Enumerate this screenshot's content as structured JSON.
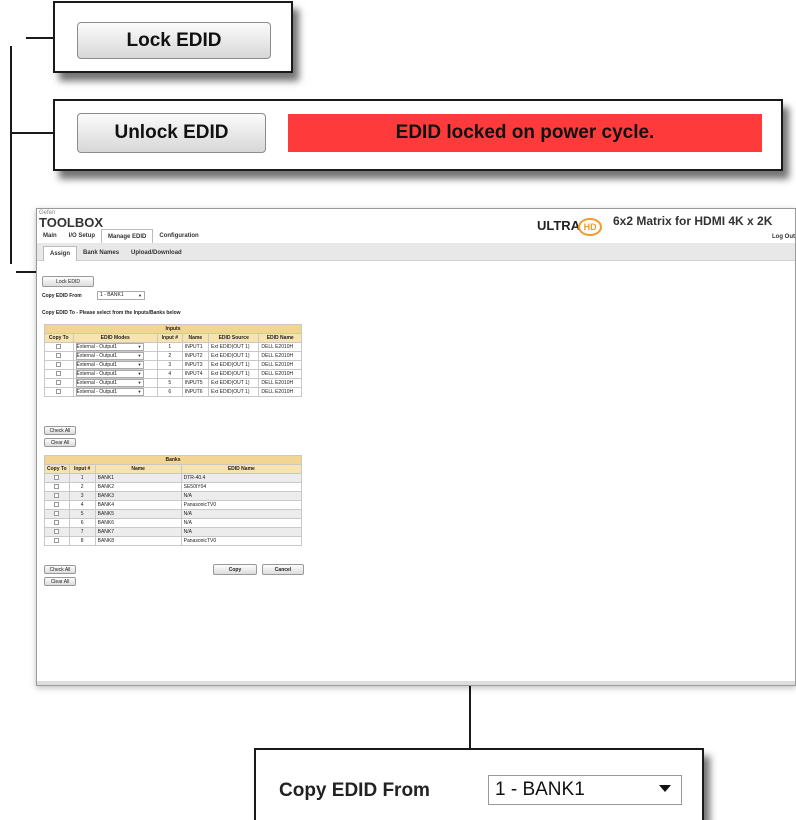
{
  "callout_lock": {
    "button_label": "Lock EDID"
  },
  "callout_unlock": {
    "button_label": "Unlock EDID",
    "status_banner": "EDID locked on power cycle."
  },
  "callout_copy": {
    "label": "Copy EDID From",
    "select_value": "1 - BANK1"
  },
  "app": {
    "brand_small": "Gefen",
    "brand": "TOOLBOX",
    "badge_text": "ULTRA",
    "badge_circle": "HD",
    "product_title": "6x2 Matrix for HDMI 4K x 2K",
    "logout": "Log Out",
    "tabs": [
      "Main",
      "I/O Setup",
      "Manage EDID",
      "Configuration"
    ],
    "subtabs": [
      "Assign",
      "Bank Names",
      "Upload/Download"
    ]
  },
  "assign": {
    "lock_button": "Lock EDID",
    "copy_from_label": "Copy EDID From",
    "copy_from_value": "1 - BANK1",
    "copy_to_label": "Copy EDID To - Please select from the Inputs/Banks below",
    "inputs": {
      "caption": "Inputs",
      "headers": [
        "Copy To",
        "EDID Modes",
        "Input #",
        "Name",
        "EDID Source",
        "EDID Name"
      ],
      "rows": [
        {
          "mode": "External - Output1",
          "num": "1",
          "name": "INPUT1",
          "source": "Ext EDID(OUT 1)",
          "edid": "DELL E2010H"
        },
        {
          "mode": "External - Output1",
          "num": "2",
          "name": "INPUT2",
          "source": "Ext EDID(OUT 1)",
          "edid": "DELL E2010H"
        },
        {
          "mode": "External - Output1",
          "num": "3",
          "name": "INPUT3",
          "source": "Ext EDID(OUT 1)",
          "edid": "DELL E2010H"
        },
        {
          "mode": "External - Output1",
          "num": "4",
          "name": "INPUT4",
          "source": "Ext EDID(OUT 1)",
          "edid": "DELL E2010H"
        },
        {
          "mode": "External - Output1",
          "num": "5",
          "name": "INPUT5",
          "source": "Ext EDID(OUT 1)",
          "edid": "DELL E2010H"
        },
        {
          "mode": "External - Output1",
          "num": "6",
          "name": "INPUT6",
          "source": "Ext EDID(OUT 1)",
          "edid": "DELL E2010H"
        }
      ]
    },
    "check_all": "Check All",
    "clear_all": "Clear All",
    "banks": {
      "caption": "Banks",
      "headers": [
        "Copy To",
        "Input #",
        "Name",
        "EDID Name"
      ],
      "rows": [
        {
          "num": "1",
          "name": "BANK1",
          "edid": "DTR-40.4"
        },
        {
          "num": "2",
          "name": "BANK2",
          "edid": "SE50IY04"
        },
        {
          "num": "3",
          "name": "BANK3",
          "edid": "N/A"
        },
        {
          "num": "4",
          "name": "BANK4",
          "edid": "PanasonicTV0"
        },
        {
          "num": "5",
          "name": "BANK5",
          "edid": "N/A"
        },
        {
          "num": "6",
          "name": "BANK6",
          "edid": "N/A"
        },
        {
          "num": "7",
          "name": "BANK7",
          "edid": "N/A"
        },
        {
          "num": "8",
          "name": "BANK8",
          "edid": "PanasonicTV0"
        }
      ]
    },
    "copy_button": "Copy",
    "cancel_button": "Cancel"
  }
}
